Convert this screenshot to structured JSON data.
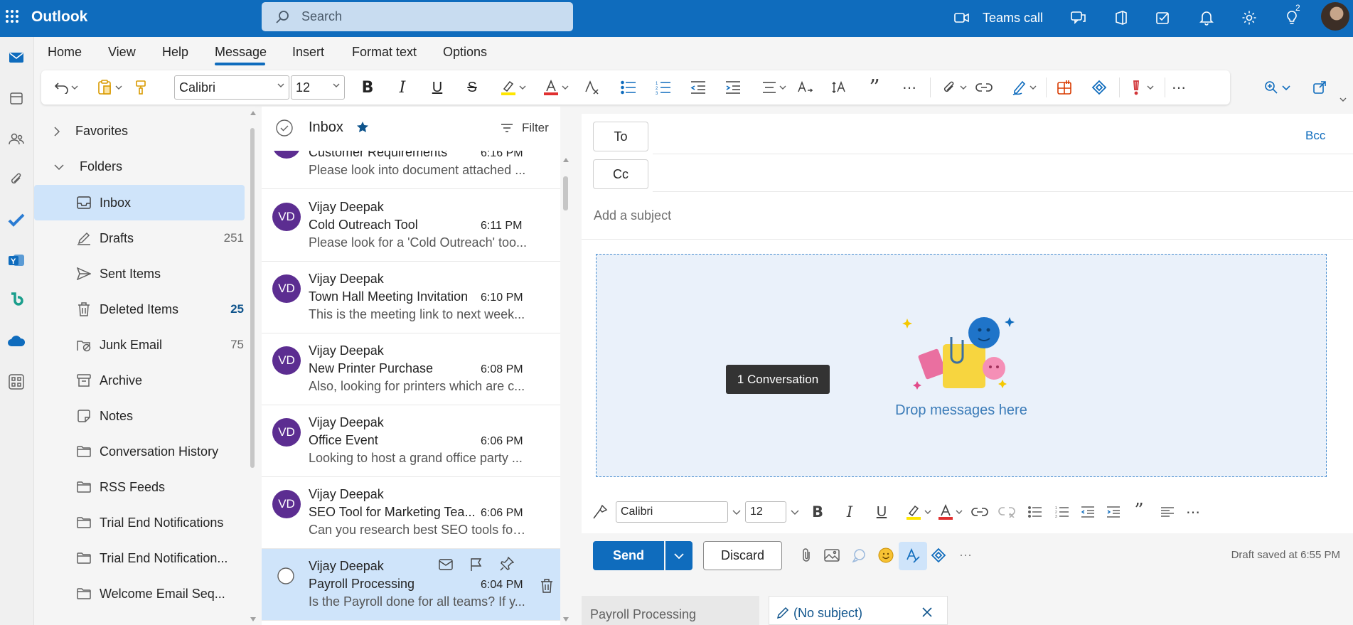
{
  "header": {
    "brand": "Outlook",
    "search_placeholder": "Search",
    "teams_call": "Teams call",
    "notification_count": "2"
  },
  "ribbon": {
    "tabs": [
      "Home",
      "View",
      "Help",
      "Message",
      "Insert",
      "Format text",
      "Options"
    ],
    "active_tab": "Message",
    "font": "Calibri",
    "size": "12"
  },
  "folders": {
    "favorites": "Favorites",
    "folders": "Folders",
    "items": [
      {
        "label": "Inbox",
        "count": ""
      },
      {
        "label": "Drafts",
        "count": "251"
      },
      {
        "label": "Sent Items",
        "count": ""
      },
      {
        "label": "Deleted Items",
        "count": "25"
      },
      {
        "label": "Junk Email",
        "count": "75"
      },
      {
        "label": "Archive",
        "count": ""
      },
      {
        "label": "Notes",
        "count": ""
      },
      {
        "label": "Conversation History",
        "count": ""
      },
      {
        "label": "RSS Feeds",
        "count": ""
      },
      {
        "label": "Trial End Notifications",
        "count": ""
      },
      {
        "label": "Trial End Notification...",
        "count": ""
      },
      {
        "label": "Welcome Email Seq...",
        "count": ""
      }
    ]
  },
  "message_list": {
    "title": "Inbox",
    "filter": "Filter",
    "messages": [
      {
        "initials": "VD",
        "from": "",
        "subject": "Customer Requirements",
        "time": "6:16 PM",
        "preview": "Please look into document attached ..."
      },
      {
        "initials": "VD",
        "from": "Vijay Deepak",
        "subject": "Cold Outreach Tool",
        "time": "6:11 PM",
        "preview": "Please look for a 'Cold Outreach' too..."
      },
      {
        "initials": "VD",
        "from": "Vijay Deepak",
        "subject": "Town Hall Meeting Invitation",
        "time": "6:10 PM",
        "preview": "This is the meeting link to next week..."
      },
      {
        "initials": "VD",
        "from": "Vijay Deepak",
        "subject": "New Printer Purchase",
        "time": "6:08 PM",
        "preview": "Also, looking for printers which are c..."
      },
      {
        "initials": "VD",
        "from": "Vijay Deepak",
        "subject": "Office Event",
        "time": "6:06 PM",
        "preview": "Looking to host a grand office party ..."
      },
      {
        "initials": "VD",
        "from": "Vijay Deepak",
        "subject": "SEO Tool for Marketing Tea...",
        "time": "6:06 PM",
        "preview": "Can you research best SEO tools for ..."
      },
      {
        "initials": "",
        "from": "Vijay Deepak",
        "subject": "Payroll Processing",
        "time": "6:04 PM",
        "preview": "Is the Payroll done for all teams? If y..."
      }
    ]
  },
  "compose": {
    "to_label": "To",
    "cc_label": "Cc",
    "bcc_label": "Bcc",
    "subject_placeholder": "Add a subject",
    "drop_text": "Drop messages here",
    "tooltip": "1 Conversation",
    "font": "Calibri",
    "size": "12",
    "send": "Send",
    "discard": "Discard",
    "draft_status": "Draft saved at 6:55 PM"
  },
  "bottom_tabs": {
    "tab1": "Payroll Processing",
    "tab2": "(No subject)"
  },
  "colors": {
    "accent": "#0f6cbd",
    "avatar": "#5c2d91",
    "selected": "#cfe4fa"
  }
}
